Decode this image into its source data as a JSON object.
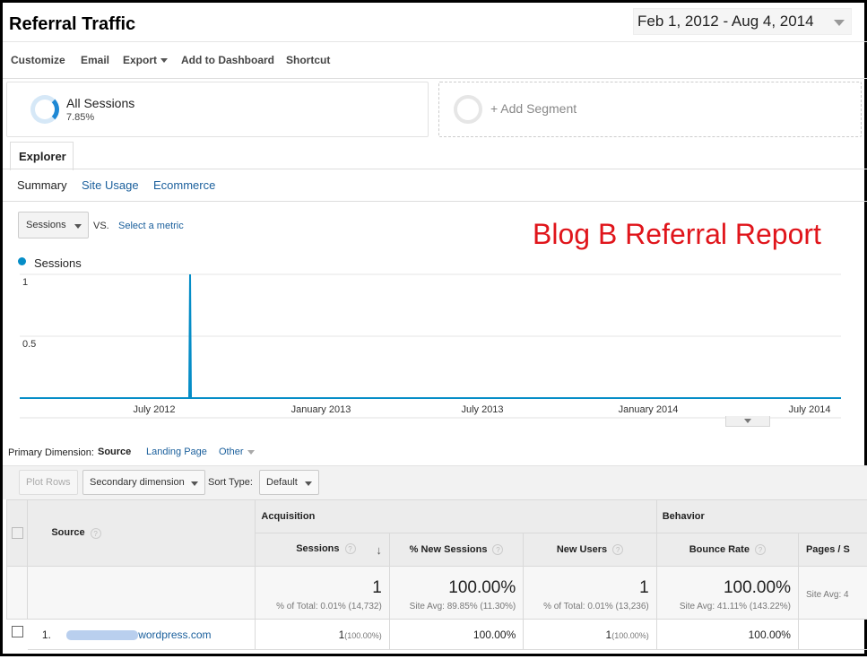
{
  "header": {
    "title": "Referral Traffic",
    "date_range": "Feb 1, 2012 - Aug 4, 2014"
  },
  "toolbar": {
    "customize": "Customize",
    "email": "Email",
    "export": "Export",
    "add_to_dashboard": "Add to Dashboard",
    "shortcut": "Shortcut"
  },
  "segments": {
    "active_name": "All Sessions",
    "active_percent": "7.85%",
    "add_label": "+ Add Segment"
  },
  "tabs": {
    "explorer": "Explorer",
    "subtabs": [
      "Summary",
      "Site Usage",
      "Ecommerce"
    ]
  },
  "metric": {
    "selected": "Sessions",
    "vs": "VS.",
    "select_metric": "Select a metric"
  },
  "annotation": "Blog B Referral Report",
  "chart_data": {
    "type": "line",
    "series": [
      {
        "name": "Sessions",
        "color": "#058dc7",
        "spike_date": "2012-09",
        "spike_value": 1,
        "baseline": 0
      }
    ],
    "yticks": [
      "1",
      "0.5"
    ],
    "ylim": [
      0,
      1
    ],
    "xticks": [
      "July 2012",
      "January 2013",
      "July 2013",
      "January 2014",
      "July 2014"
    ],
    "grid": true
  },
  "primary_dimension": {
    "label": "Primary Dimension:",
    "options": [
      "Source",
      "Landing Page",
      "Other"
    ]
  },
  "table_controls": {
    "plot_rows": "Plot Rows",
    "secondary_dimension": "Secondary dimension",
    "sort_type_label": "Sort Type:",
    "sort_type_value": "Default"
  },
  "table": {
    "groups": {
      "acquisition": "Acquisition",
      "behavior": "Behavior"
    },
    "source_header": "Source",
    "columns": [
      "Sessions",
      "% New Sessions",
      "New Users",
      "Bounce Rate",
      "Pages / S"
    ],
    "totals": [
      {
        "value": "1",
        "note": "% of Total: 0.01% (14,732)"
      },
      {
        "value": "100.00%",
        "note": "Site Avg: 89.85% (11.30%)"
      },
      {
        "value": "1",
        "note": "% of Total: 0.01% (13,236)"
      },
      {
        "value": "100.00%",
        "note": "Site Avg: 41.11% (143.22%)"
      },
      {
        "value": "",
        "note": "Site Avg: 4"
      }
    ],
    "rows": [
      {
        "index": "1.",
        "source_suffix": "wordpress.com",
        "sessions": "1",
        "sessions_pct": "(100.00%)",
        "new_sessions": "100.00%",
        "new_users": "1",
        "new_users_pct": "(100.00%)",
        "bounce_rate": "100.00%"
      }
    ]
  }
}
